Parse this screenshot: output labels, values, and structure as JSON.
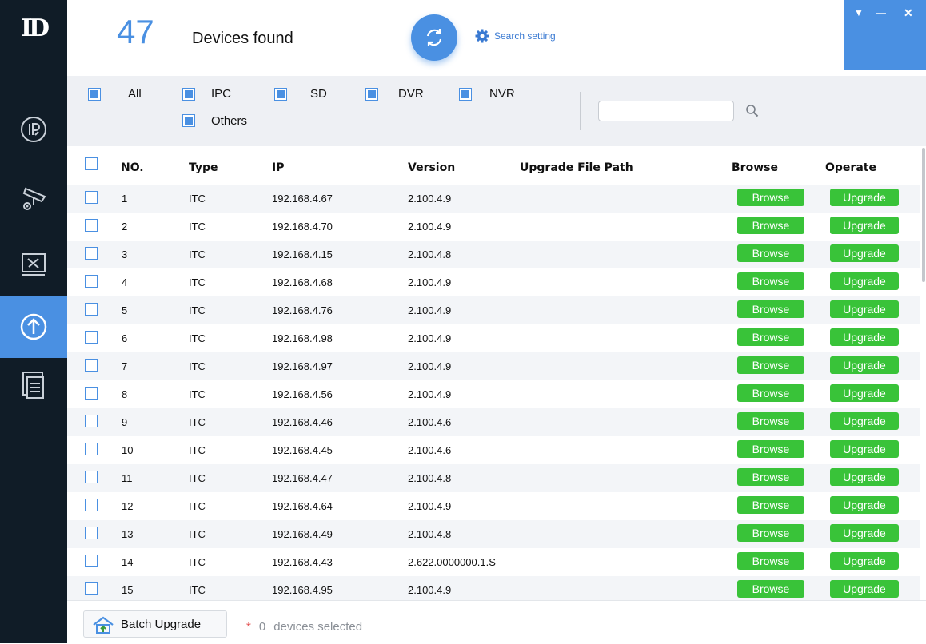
{
  "app": {
    "logo_text": "ID"
  },
  "sidebar": {
    "items": [
      {
        "name": "ip-config",
        "icon": "ip-icon"
      },
      {
        "name": "device-config",
        "icon": "camera-gear-icon"
      },
      {
        "name": "system-settings",
        "icon": "tools-icon"
      },
      {
        "name": "device-upgrade",
        "icon": "upgrade-icon",
        "active": true
      },
      {
        "name": "documentation",
        "icon": "document-icon"
      }
    ]
  },
  "header": {
    "device_count": "47",
    "devices_found_label": "Devices found",
    "search_setting_label": "Search setting",
    "window_controls": {
      "menu": "▼",
      "minimize": "—",
      "close": "✕"
    }
  },
  "filters": {
    "items": [
      {
        "label": "All",
        "checked": true
      },
      {
        "label": "IPC",
        "checked": true
      },
      {
        "label": "SD",
        "checked": true
      },
      {
        "label": "DVR",
        "checked": true
      },
      {
        "label": "NVR",
        "checked": true
      },
      {
        "label": "Others",
        "checked": true
      }
    ],
    "search_value": "",
    "search_placeholder": ""
  },
  "table": {
    "headers": {
      "no": "NO.",
      "type": "Type",
      "ip": "IP",
      "version": "Version",
      "path": "Upgrade File Path",
      "browse": "Browse",
      "operate": "Operate"
    },
    "browse_label": "Browse",
    "upgrade_label": "Upgrade",
    "rows": [
      {
        "no": "1",
        "type": "ITC",
        "ip": "192.168.4.67",
        "version": "2.100.4.9",
        "path": ""
      },
      {
        "no": "2",
        "type": "ITC",
        "ip": "192.168.4.70",
        "version": "2.100.4.9",
        "path": ""
      },
      {
        "no": "3",
        "type": "ITC",
        "ip": "192.168.4.15",
        "version": "2.100.4.8",
        "path": ""
      },
      {
        "no": "4",
        "type": "ITC",
        "ip": "192.168.4.68",
        "version": "2.100.4.9",
        "path": ""
      },
      {
        "no": "5",
        "type": "ITC",
        "ip": "192.168.4.76",
        "version": "2.100.4.9",
        "path": ""
      },
      {
        "no": "6",
        "type": "ITC",
        "ip": "192.168.4.98",
        "version": "2.100.4.9",
        "path": ""
      },
      {
        "no": "7",
        "type": "ITC",
        "ip": "192.168.4.97",
        "version": "2.100.4.9",
        "path": ""
      },
      {
        "no": "8",
        "type": "ITC",
        "ip": "192.168.4.56",
        "version": "2.100.4.9",
        "path": ""
      },
      {
        "no": "9",
        "type": "ITC",
        "ip": "192.168.4.46",
        "version": "2.100.4.6",
        "path": ""
      },
      {
        "no": "10",
        "type": "ITC",
        "ip": "192.168.4.45",
        "version": "2.100.4.6",
        "path": ""
      },
      {
        "no": "11",
        "type": "ITC",
        "ip": "192.168.4.47",
        "version": "2.100.4.8",
        "path": ""
      },
      {
        "no": "12",
        "type": "ITC",
        "ip": "192.168.4.64",
        "version": "2.100.4.9",
        "path": ""
      },
      {
        "no": "13",
        "type": "ITC",
        "ip": "192.168.4.49",
        "version": "2.100.4.8",
        "path": ""
      },
      {
        "no": "14",
        "type": "ITC",
        "ip": "192.168.4.43",
        "version": "2.622.0000000.1.S",
        "path": ""
      },
      {
        "no": "15",
        "type": "ITC",
        "ip": "192.168.4.95",
        "version": "2.100.4.9",
        "path": ""
      }
    ]
  },
  "footer": {
    "batch_upgrade_label": "Batch Upgrade",
    "star": "*",
    "selected_count": "0",
    "selected_label": "devices selected"
  },
  "colors": {
    "accent": "#4a90e2",
    "sidebar_bg": "#101c27",
    "button_green": "#39c339",
    "filter_bg": "#eef0f4"
  }
}
